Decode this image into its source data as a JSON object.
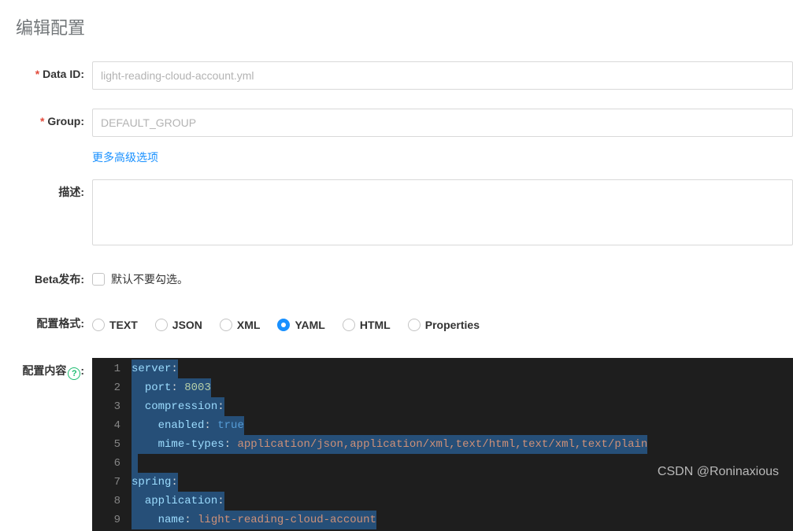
{
  "page": {
    "title": "编辑配置"
  },
  "form": {
    "dataId": {
      "label": "Data ID:",
      "value": "light-reading-cloud-account.yml"
    },
    "group": {
      "label": "Group:",
      "value": "DEFAULT_GROUP"
    },
    "advancedLink": "更多高级选项",
    "description": {
      "label": "描述:",
      "value": ""
    },
    "beta": {
      "label": "Beta发布:",
      "hint": "默认不要勾选。",
      "checked": false
    },
    "format": {
      "label": "配置格式:",
      "options": [
        "TEXT",
        "JSON",
        "XML",
        "YAML",
        "HTML",
        "Properties"
      ],
      "selected": "YAML"
    },
    "content": {
      "label": "配置内容"
    }
  },
  "editor": {
    "lines": [
      {
        "n": 1,
        "tokens": [
          [
            "key",
            "server"
          ],
          [
            "colon",
            ":"
          ]
        ]
      },
      {
        "n": 2,
        "indent": 2,
        "tokens": [
          [
            "key",
            "port"
          ],
          [
            "colon",
            ": "
          ],
          [
            "num",
            "8003"
          ]
        ]
      },
      {
        "n": 3,
        "indent": 2,
        "tokens": [
          [
            "key",
            "compression"
          ],
          [
            "colon",
            ":"
          ]
        ]
      },
      {
        "n": 4,
        "indent": 4,
        "tokens": [
          [
            "key",
            "enabled"
          ],
          [
            "colon",
            ": "
          ],
          [
            "bool",
            "true"
          ]
        ]
      },
      {
        "n": 5,
        "indent": 4,
        "tokens": [
          [
            "key",
            "mime-types"
          ],
          [
            "colon",
            ": "
          ],
          [
            "str",
            "application/json,application/xml,text/html,text/xml,text/plain"
          ]
        ]
      },
      {
        "n": 6,
        "indent": 0,
        "tokens": []
      },
      {
        "n": 7,
        "tokens": [
          [
            "key",
            "spring"
          ],
          [
            "colon",
            ":"
          ]
        ]
      },
      {
        "n": 8,
        "indent": 2,
        "tokens": [
          [
            "key",
            "application"
          ],
          [
            "colon",
            ":"
          ]
        ]
      },
      {
        "n": 9,
        "indent": 4,
        "tokens": [
          [
            "key",
            "name"
          ],
          [
            "colon",
            ": "
          ],
          [
            "str",
            "light-reading-cloud-account"
          ]
        ]
      }
    ]
  },
  "watermark": "CSDN @Roninaxious"
}
